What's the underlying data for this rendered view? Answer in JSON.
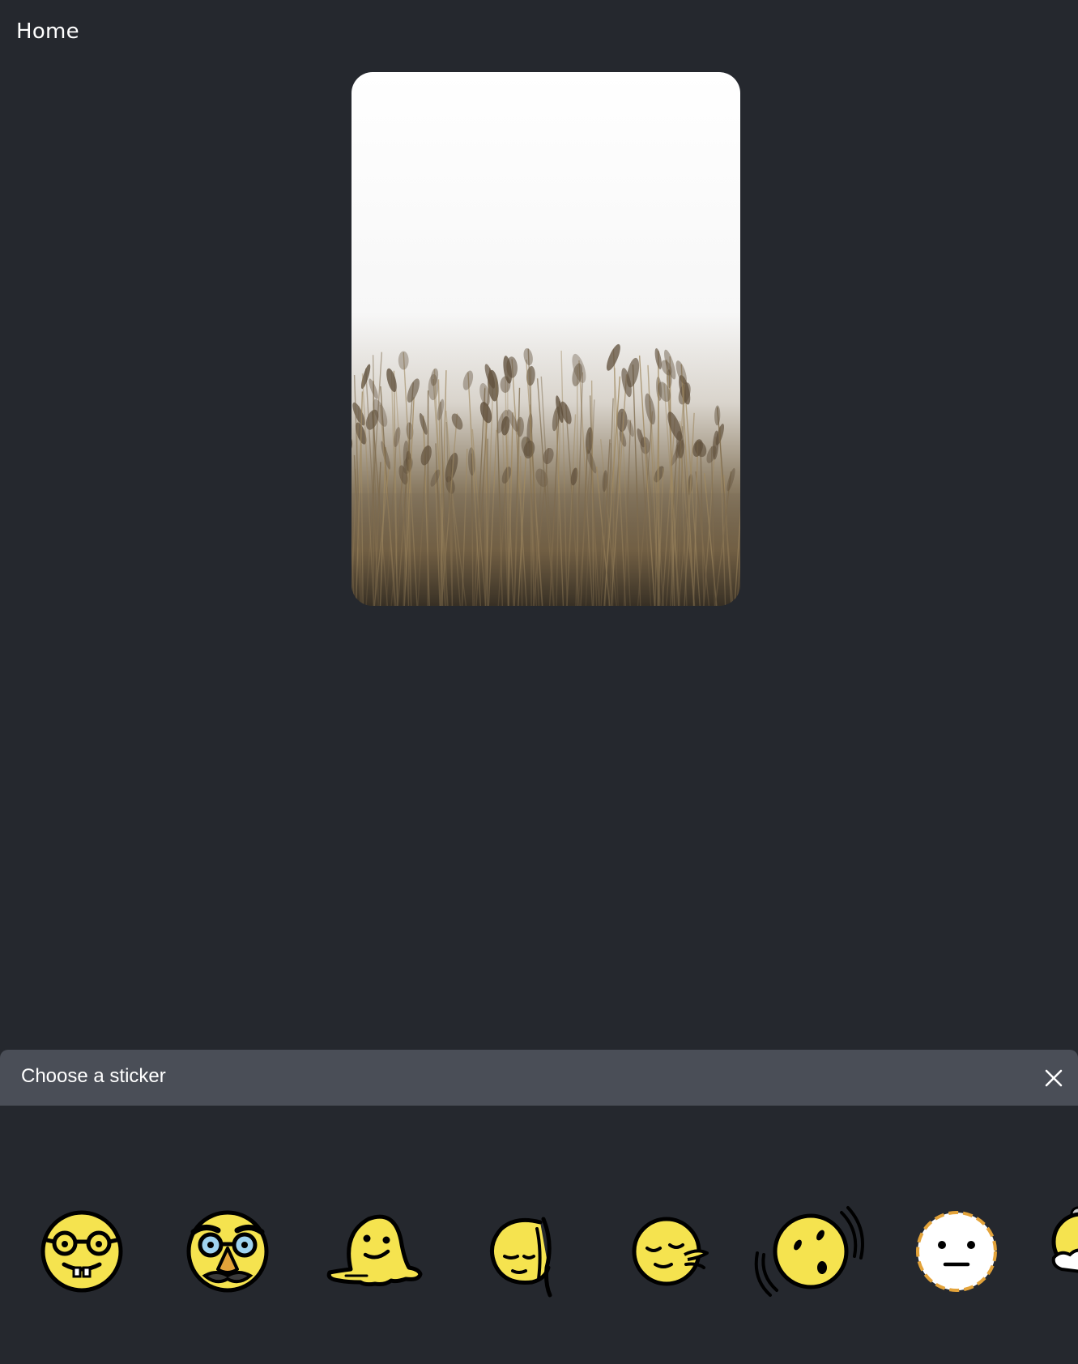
{
  "header": {
    "home_label": "Home"
  },
  "photo": {
    "subject": "foggy-reed-field"
  },
  "sticker_panel": {
    "title": "Choose a sticker",
    "close_icon": "close-icon",
    "stickers": [
      {
        "icon": "nerd-face-icon"
      },
      {
        "icon": "disguised-face-icon"
      },
      {
        "icon": "melting-face-icon"
      },
      {
        "icon": "face-in-clouds-icon"
      },
      {
        "icon": "face-exhaling-icon"
      },
      {
        "icon": "dizzy-face-icon"
      },
      {
        "icon": "dotted-line-face-icon"
      },
      {
        "icon": "face-with-cloud-icon"
      }
    ]
  },
  "colors": {
    "background": "#25282e",
    "panel_header": "#4a4e57",
    "emoji_yellow": "#f5e34f",
    "emoji_outline": "#000000"
  }
}
